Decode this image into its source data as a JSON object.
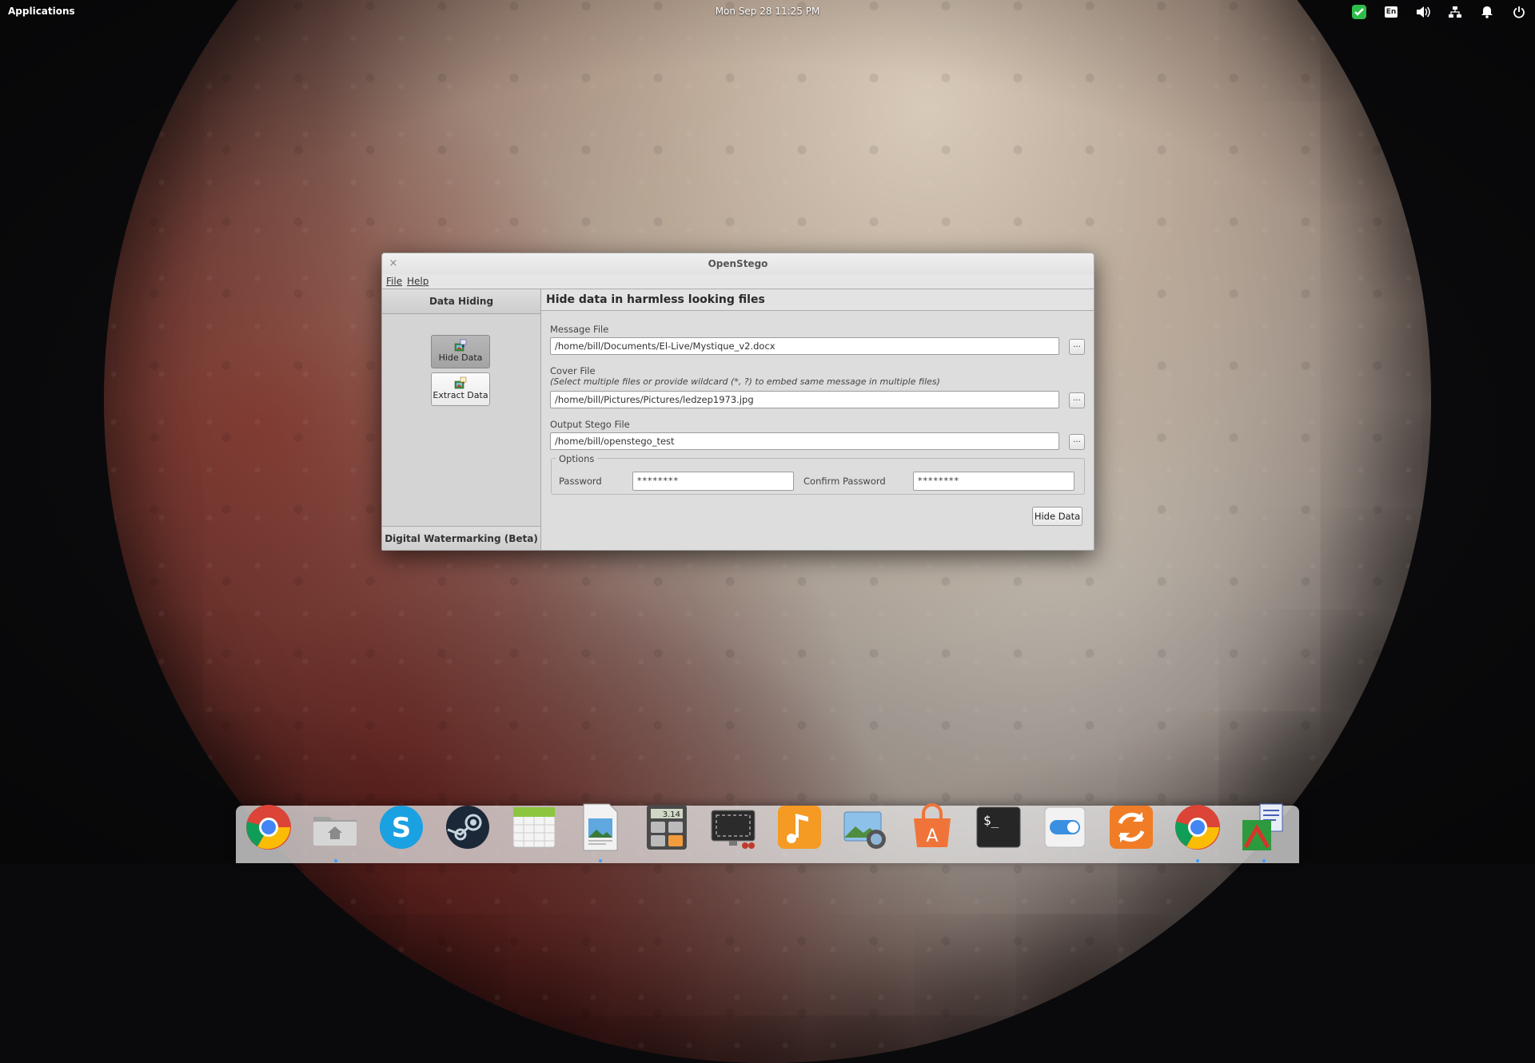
{
  "top_panel": {
    "applications": "Applications",
    "clock": "Mon Sep 28    11:25 PM",
    "keyboard_layout": "En"
  },
  "window": {
    "title": "OpenStego",
    "close_glyph": "×",
    "menu": {
      "file": "File",
      "help": "Help"
    }
  },
  "sidebar": {
    "data_hiding_header": "Data Hiding",
    "hide_data_label": "Hide Data",
    "extract_data_label": "Extract Data",
    "watermarking_header": "Digital Watermarking (Beta)"
  },
  "main": {
    "title": "Hide data in harmless looking files",
    "message_file": {
      "label": "Message File",
      "value": "/home/bill/Documents/El-Live/Mystique_v2.docx"
    },
    "cover_file": {
      "label": "Cover File",
      "note": "(Select multiple files or provide wildcard (*, ?) to embed same message in multiple files)",
      "value": "/home/bill/Pictures/Pictures/ledzep1973.jpg"
    },
    "output_file": {
      "label": "Output Stego File",
      "value": "/home/bill/openstego_test"
    },
    "browse_label": "...",
    "options": {
      "legend": "Options",
      "password_label": "Password",
      "password_value": "********",
      "confirm_label": "Confirm Password",
      "confirm_value": "********"
    },
    "hide_button": "Hide Data"
  },
  "dock": {
    "items": [
      "chrome-icon",
      "home-folder-icon",
      "skype-icon",
      "steam-icon",
      "calendar-icon",
      "image-viewer-icon",
      "calculator-icon",
      "screenshot-icon",
      "music-icon",
      "photos-icon",
      "app-store-icon",
      "terminal-icon",
      "switchboard-icon",
      "update-icon",
      "chrome-icon",
      "opengapps-icon"
    ],
    "calculator_display": "3.14"
  },
  "colors": {
    "window_bg": "#d9d9d9",
    "sidebar_selected": "#a8a8a8",
    "tray_check": "#2ebd4a",
    "dock_dot": "#3aa0ff"
  }
}
